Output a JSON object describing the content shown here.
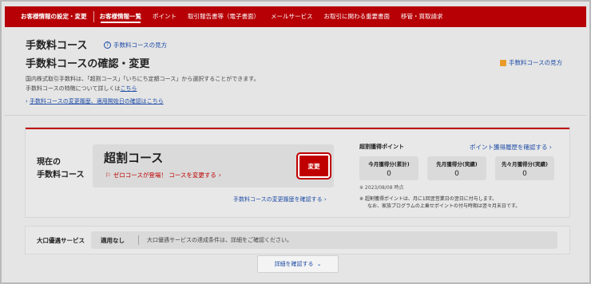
{
  "nav": {
    "items": [
      "お客様情報の設定・変更",
      "お客様情報一覧",
      "ポイント",
      "取引報告書等（電子書面）",
      "メールサービス",
      "お取引に関わる重要書面",
      "移管・買取請求"
    ],
    "active_index": 1
  },
  "page": {
    "title": "手数料コース",
    "help_link": "手数料コースの見方",
    "subtitle": "手数料コースの確認・変更",
    "right_link": "手数料コースの見方",
    "desc1": "国内株式取引手数料は、「超割コース」「いちにち定額コース」から選択することができます。",
    "desc2_prefix": "手数料コースの特徴について詳しくは",
    "desc2_link": "こちら",
    "history_link": "手数料コースの変更履歴、適用開始日の確認はこちら"
  },
  "current": {
    "label_line1": "現在の",
    "label_line2": "手数料コース",
    "course_name": "超割コース",
    "zero_link": "ゼロコースが登場！ コースを変更する",
    "change_button": "変更",
    "change_history_link": "手数料コースの変更履歴を確認する"
  },
  "points": {
    "title": "超割獲得ポイント",
    "history_link": "ポイント獲得履歴を確認する",
    "boxes": [
      {
        "label": "今月獲得分(累計)",
        "value": "0"
      },
      {
        "label": "先月獲得分(実績)",
        "value": "0"
      },
      {
        "label": "先々月獲得分(実績)",
        "value": "0"
      }
    ],
    "date_note": "※ 2023/08/08 時点",
    "note1": "※ 超割獲得ポイントは、月に1回翌営業日の翌日に付与します。",
    "note2": "なお、家族プログラムの上乗せポイントの付与時期は翌々月末日です。"
  },
  "large_order": {
    "label": "大口優遇サービス",
    "status": "適用なし",
    "text": "大口優遇サービスの達成条件は、詳細をご確認ください。"
  },
  "detail_button": "詳細を確認する",
  "colors": {
    "brand_red": "#b60005",
    "link_blue": "#1e4ca6"
  }
}
